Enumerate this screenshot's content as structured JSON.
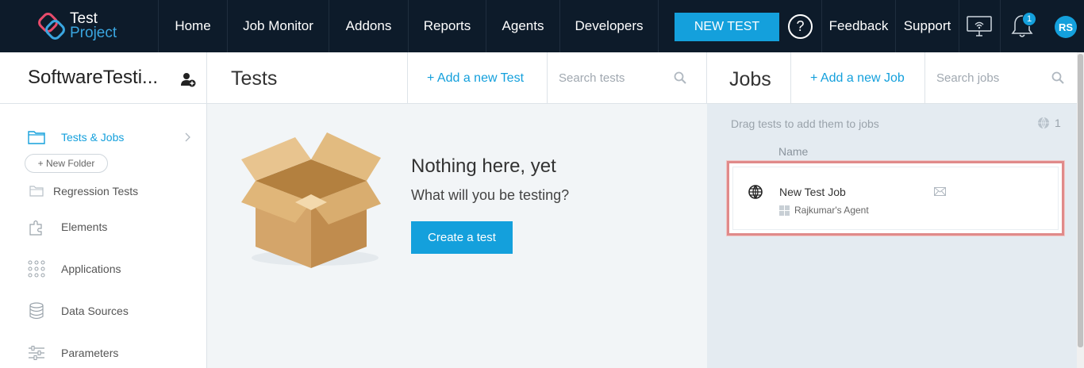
{
  "brand": {
    "line1": "Test",
    "line2": "Project"
  },
  "nav": {
    "items": [
      {
        "label": "Home"
      },
      {
        "label": "Job Monitor"
      },
      {
        "label": "Addons"
      },
      {
        "label": "Reports"
      },
      {
        "label": "Agents"
      },
      {
        "label": "Developers"
      }
    ],
    "new_test_label": "NEW TEST",
    "help_glyph": "?",
    "feedback_label": "Feedback",
    "support_label": "Support",
    "notification_count": "1",
    "avatar_initials": "RS"
  },
  "project": {
    "title": "SoftwareTesti..."
  },
  "tests_header": {
    "title": "Tests",
    "add_label": "+  Add a new Test",
    "search_placeholder": "Search tests"
  },
  "jobs_header": {
    "title": "Jobs",
    "add_label": "+  Add a new Job",
    "search_placeholder": "Search jobs"
  },
  "sidebar": {
    "items": [
      {
        "label": "Tests & Jobs",
        "icon": "folder-icon",
        "active": true
      },
      {
        "label": "Regression Tests",
        "icon": "folder-icon"
      },
      {
        "label": "Elements",
        "icon": "puzzle-icon"
      },
      {
        "label": "Applications",
        "icon": "apps-grid-icon"
      },
      {
        "label": "Data Sources",
        "icon": "database-icon"
      },
      {
        "label": "Parameters",
        "icon": "sliders-icon"
      }
    ],
    "new_folder_label": "+ New Folder"
  },
  "empty_state": {
    "title": "Nothing here, yet",
    "subtitle": "What will you be testing?",
    "button_label": "Create a test"
  },
  "jobs": {
    "hint": "Drag tests to add them to jobs",
    "count": "1",
    "column_name": "Name",
    "list": [
      {
        "name": "New Test Job",
        "agent": "Rajkumar's Agent",
        "platform": "web"
      }
    ]
  },
  "colors": {
    "accent": "#14a0dc",
    "nav_bg": "#0d1b2a",
    "highlight": "#e08a8a"
  }
}
